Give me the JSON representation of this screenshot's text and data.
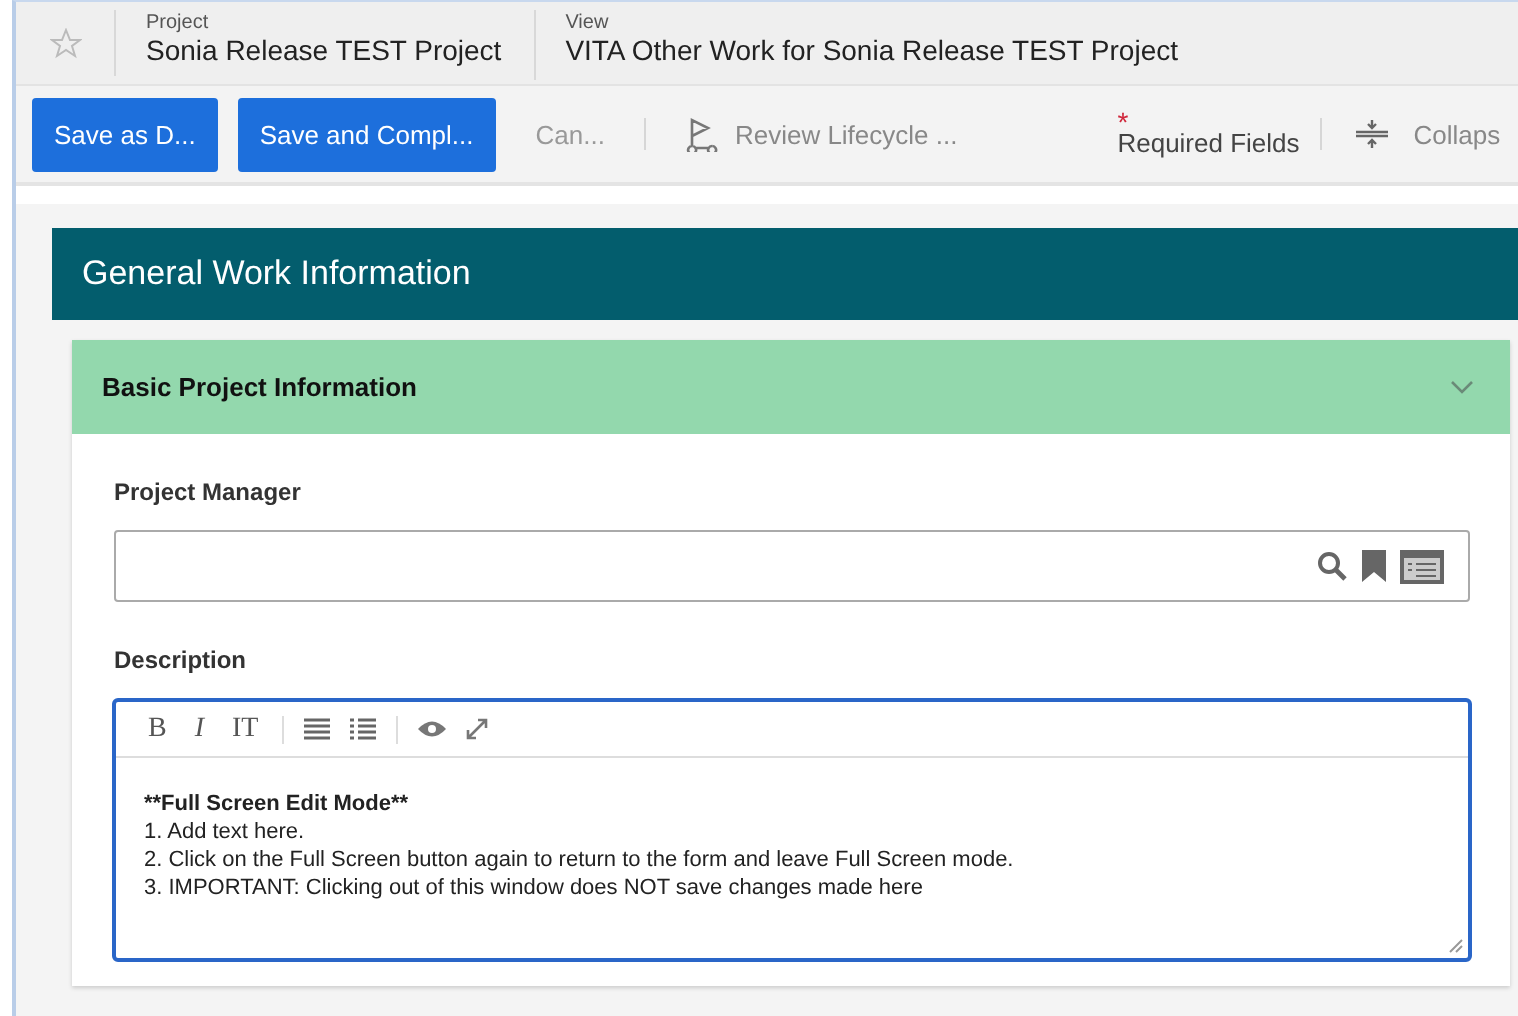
{
  "header": {
    "project": {
      "label": "Project",
      "value": "Sonia Release TEST Project"
    },
    "view": {
      "label": "View",
      "value": "VITA Other Work for Sonia Release TEST Project"
    }
  },
  "toolbar": {
    "buttons": [
      {
        "label": "Save as D...",
        "kind": "primary"
      },
      {
        "label": "Save and Compl...",
        "kind": "primary"
      },
      {
        "label": "Can...",
        "kind": "plain"
      },
      {
        "label": "Review Lifecycle ...",
        "kind": "lifecycle"
      }
    ],
    "required_mark": "*",
    "required_label": "Required Fields",
    "collapse": "Collaps"
  },
  "section": {
    "title": "General Work Information",
    "panel": {
      "title": "Basic Project Information",
      "expanded": true,
      "fields": [
        {
          "label": "Project Manager",
          "kind": "lookup"
        },
        {
          "label": "Description",
          "kind": "richtext",
          "toolbar": [
            "B",
            "I",
            "IT"
          ],
          "lines": [
            {
              "text": "**Full Screen Edit Mode**",
              "bold": true
            },
            {
              "text": "1. Add text here.",
              "bold": false
            },
            {
              "text": "2. Click on the Full Screen button again to return to the form and leave Full Screen mode.",
              "bold": false
            },
            {
              "text": "3. IMPORTANT: Clicking out of this window does NOT save changes made here",
              "bold": false
            }
          ]
        }
      ]
    }
  }
}
